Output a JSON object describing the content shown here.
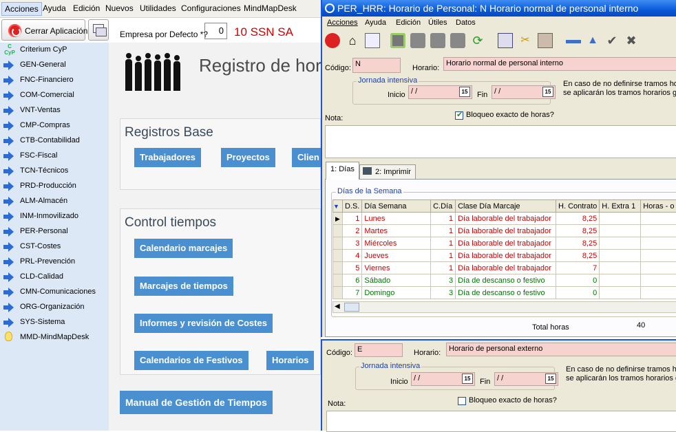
{
  "menubar": {
    "items": [
      "Acciones",
      "Ayuda",
      "Edición",
      "Nuevos",
      "Utilidades",
      "Configuraciones",
      "MindMapDesk"
    ]
  },
  "toolbar": {
    "close_label": "Cerrar Aplicación",
    "empresa_label": "Empresa por Defecto *?",
    "empresa_value": "0",
    "empresa_name": "10 SSN SA"
  },
  "sidebar": {
    "items": [
      {
        "label": "Criterium CyP",
        "icon": "criterium-logo-icon"
      },
      {
        "label": "GEN-General",
        "icon": "arrow-right-icon"
      },
      {
        "label": "FNC-Financiero",
        "icon": "arrow-right-icon"
      },
      {
        "label": "COM-Comercial",
        "icon": "arrow-right-icon"
      },
      {
        "label": "VNT-Ventas",
        "icon": "arrow-right-icon"
      },
      {
        "label": "CMP-Compras",
        "icon": "arrow-right-icon"
      },
      {
        "label": "CTB-Contabilidad",
        "icon": "arrow-right-icon"
      },
      {
        "label": "FSC-Fiscal",
        "icon": "arrow-right-icon"
      },
      {
        "label": "TCN-Técnicos",
        "icon": "arrow-right-icon"
      },
      {
        "label": "PRD-Producción",
        "icon": "arrow-right-icon"
      },
      {
        "label": "ALM-Almacén",
        "icon": "arrow-right-icon"
      },
      {
        "label": "INM-Inmovilizado",
        "icon": "arrow-right-icon"
      },
      {
        "label": "PER-Personal",
        "icon": "arrow-right-icon"
      },
      {
        "label": "CST-Costes",
        "icon": "arrow-right-icon"
      },
      {
        "label": "PRL-Prevención",
        "icon": "arrow-right-icon"
      },
      {
        "label": "CLD-Calidad",
        "icon": "arrow-right-icon"
      },
      {
        "label": "CMN-Comunicaciones",
        "icon": "arrow-right-icon"
      },
      {
        "label": "ORG-Organización",
        "icon": "arrow-right-icon"
      },
      {
        "label": "SYS-Sistema",
        "icon": "arrow-right-icon"
      },
      {
        "label": "MMD-MindMapDesk",
        "icon": "lightbulb-icon"
      }
    ]
  },
  "main": {
    "title": "Registro de hor",
    "registros_base": {
      "title": "Registros Base",
      "buttons": [
        "Trabajadores",
        "Proyectos",
        "Clien"
      ]
    },
    "control_tiempos": {
      "title": "Control tiempos",
      "buttons": [
        "Calendario marcajes",
        "Marcajes de tiempos",
        "Informes y revisión de Costes",
        "Calendarios de Festivos",
        "Horarios"
      ]
    },
    "manual_button": "Manual de Gestión de Tiempos"
  },
  "win1": {
    "title": "PER_HRR: Horario de Personal: N Horario normal de personal interno",
    "menu": [
      "Acciones",
      "Ayuda",
      "Edición",
      "Útiles",
      "Datos"
    ],
    "codigo_label": "Código:",
    "codigo_value": "N",
    "horario_label": "Horario:",
    "horario_value": "Horario normal de personal interno",
    "jornada_title": "Jornada intensiva",
    "inicio_label": "Inicio",
    "inicio_value": "/ /",
    "fin_label": "Fin",
    "fin_value": "/ /",
    "info_line1": "En caso de no definirse tramos hora",
    "info_line2": "se aplicarán los tramos horarios gen",
    "bloqueo_label": "Bloqueo exacto de horas?",
    "nota_label": "Nota:",
    "tabs": [
      "1: Días",
      "2: Imprimir"
    ],
    "dias_title": "Días de la Semana",
    "columns": [
      "D.S.",
      "Día Semana",
      "C.Día",
      "Clase Día Marcaje",
      "H. Contrato",
      "H. Extra 1",
      "Horas - o +"
    ],
    "rows": [
      {
        "ds": "1",
        "dia": "Lunes",
        "cdia": "1",
        "clase": "Día laborable del trabajador",
        "contrato": "8,25",
        "color": "#cc0000"
      },
      {
        "ds": "2",
        "dia": "Martes",
        "cdia": "1",
        "clase": "Día laborable del trabajador",
        "contrato": "8,25",
        "color": "#cc0000"
      },
      {
        "ds": "3",
        "dia": "Miércoles",
        "cdia": "1",
        "clase": "Día laborable del trabajador",
        "contrato": "8,25",
        "color": "#cc0000"
      },
      {
        "ds": "4",
        "dia": "Jueves",
        "cdia": "1",
        "clase": "Día laborable del trabajador",
        "contrato": "8,25",
        "color": "#cc0000"
      },
      {
        "ds": "5",
        "dia": "Viernes",
        "cdia": "1",
        "clase": "Día laborable del trabajador",
        "contrato": "7",
        "color": "#cc0000"
      },
      {
        "ds": "6",
        "dia": "Sábado",
        "cdia": "3",
        "clase": "Día de descanso o festivo",
        "contrato": "0",
        "color": "#007700"
      },
      {
        "ds": "7",
        "dia": "Domingo",
        "cdia": "3",
        "clase": "Día de descanso o festivo",
        "contrato": "0",
        "color": "#007700"
      }
    ],
    "total_label": "Total horas",
    "total_value": "40"
  },
  "win2": {
    "codigo_label": "Código:",
    "codigo_value": "E",
    "horario_label": "Horario:",
    "horario_value": "Horario de personal externo",
    "jornada_title": "Jornada intensiva",
    "inicio_label": "Inicio",
    "inicio_value": "/ /",
    "fin_label": "Fin",
    "fin_value": "/ /",
    "info_line1": "En caso de no definirse tramos hor",
    "info_line2": "se aplicarán los tramos horarios ge",
    "bloqueo_label": "Bloqueo exacto de horas?",
    "nota_label": "Nota:"
  },
  "colors": {
    "accent_blue": "#4a90d0",
    "title_blue": "#0a5ad8",
    "field_pink": "#f7d3cf",
    "company_red": "#d00000"
  }
}
